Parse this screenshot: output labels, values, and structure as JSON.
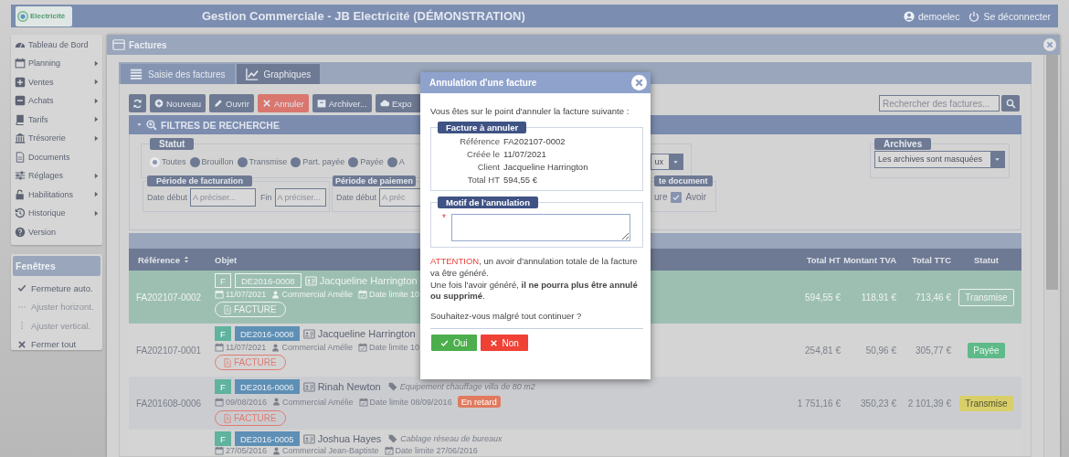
{
  "header": {
    "logo_text": "Electricité",
    "title": "Gestion Commerciale - JB Electricité (DÉMONSTRATION)",
    "user": "demoelec",
    "logout": "Se déconnecter"
  },
  "sidebar": {
    "items": [
      {
        "label": "Tableau de Bord",
        "submenu": false
      },
      {
        "label": "Planning",
        "submenu": true
      },
      {
        "label": "Ventes",
        "submenu": true
      },
      {
        "label": "Achats",
        "submenu": true
      },
      {
        "label": "Tarifs",
        "submenu": true
      },
      {
        "label": "Trésorerie",
        "submenu": true
      },
      {
        "label": "Documents",
        "submenu": false
      },
      {
        "label": "Réglages",
        "submenu": true
      },
      {
        "label": "Habilitations",
        "submenu": true
      },
      {
        "label": "Historique",
        "submenu": true
      },
      {
        "label": "Version",
        "submenu": false
      }
    ]
  },
  "windows_menu": {
    "title": "Fenêtres",
    "items": [
      {
        "label": "Fermeture auto.",
        "disabled": false
      },
      {
        "label": "Ajuster horizont.",
        "disabled": true
      },
      {
        "label": "Ajuster vertical.",
        "disabled": true
      },
      {
        "label": "Fermer tout",
        "disabled": false
      }
    ]
  },
  "window": {
    "title": "Factures"
  },
  "tabs": [
    {
      "label": "Saisie des factures",
      "selected": true
    },
    {
      "label": "Graphiques",
      "selected": false
    }
  ],
  "toolbar": {
    "buttons": [
      {
        "label": "Nouveau",
        "kind": "default"
      },
      {
        "label": "Ouvrir",
        "kind": "default"
      },
      {
        "label": "Annuler",
        "kind": "danger"
      },
      {
        "label": "Archiver...",
        "kind": "default"
      },
      {
        "label": "Expo",
        "kind": "default"
      }
    ]
  },
  "search": {
    "placeholder": "Rechercher des factures..."
  },
  "filters": {
    "title": "FILTRES DE RECHERCHE",
    "status": {
      "legend": "Statut",
      "options": [
        {
          "label": "Toutes",
          "selected": true
        },
        {
          "label": "Brouillon",
          "selected": false
        },
        {
          "label": "Transmise",
          "selected": false
        },
        {
          "label": "Part. payée",
          "selected": false
        },
        {
          "label": "Payée",
          "selected": false
        },
        {
          "label": "A",
          "selected": false
        }
      ],
      "select_value": "ux"
    },
    "billing_period": {
      "legend": "Période de facturation",
      "start_label": "Date début",
      "start_placeholder": "A préciser...",
      "end_label": "Fin",
      "end_placeholder": "A préciser..."
    },
    "payment_period": {
      "legend": "Période de paiemen",
      "start_label": "Date début",
      "start_placeholder": "A préc"
    },
    "document_type": {
      "legend": "te document",
      "partial_label": "ure",
      "options": [
        {
          "label": "Avoir",
          "checked": true
        }
      ]
    },
    "archives": {
      "legend": "Archives",
      "value": "Les archives sont masquées"
    }
  },
  "table": {
    "columns": [
      "Référence",
      "Objet",
      "Total HT",
      "Montant TVA",
      "Total TTC",
      "Statut"
    ],
    "rows": [
      {
        "reference": "FA202107-0002",
        "selected": true,
        "type": "F",
        "quote": "DE2016-0008",
        "client": "Jacqueline Harrington",
        "date": "11/07/2021",
        "sales_rep": "Commercial Amélie",
        "due": "Date limite 10",
        "document": "FACTURE",
        "total_ht": "594,55 €",
        "vat": "118,91 €",
        "total_ttc": "713,46 €",
        "status": {
          "label": "Transmise",
          "kind": "sent"
        }
      },
      {
        "reference": "FA202107-0001",
        "selected": false,
        "type": "F",
        "quote": "DE2016-0008",
        "client": "Jacqueline Harrington",
        "date": "11/07/2021",
        "sales_rep": "Commercial Amélie",
        "due": "Date limite 10",
        "document": "FACTURE",
        "total_ht": "254,81 €",
        "vat": "50,96 €",
        "total_ttc": "305,77 €",
        "status": {
          "label": "Payée",
          "kind": "paid"
        }
      },
      {
        "reference": "FA201608-0006",
        "selected": false,
        "type": "F",
        "quote": "DE2016-0006",
        "client": "Rinah Newton",
        "description": "Equipement chauffage villa de 80 m2",
        "date": "09/08/2016",
        "sales_rep": "Commercial Amélie",
        "due": "Date limite 08/09/2016",
        "late": "En retard",
        "document": "FACTURE",
        "total_ht": "1 751,16 €",
        "vat": "350,23 €",
        "total_ttc": "2 101,39 €",
        "status": {
          "label": "Transmise",
          "kind": "sent"
        }
      },
      {
        "selected": false,
        "type": "F",
        "quote": "DE2016-0005",
        "client": "Joshua Hayes",
        "description": "Cablage réseau de bureaux",
        "date": "27/05/2016",
        "sales_rep": "Commercial Jean-Baptiste",
        "due": "Date limite 27/06/2016"
      }
    ]
  },
  "dialog": {
    "title": "Annulation d'une facture",
    "intro": "Vous êtes sur le point d'annuler la facture suivante :",
    "invoice_legend": "Facture à annuler",
    "fields": [
      {
        "label": "Référence",
        "value": "FA202107-0002"
      },
      {
        "label": "Créée le",
        "value": "11/07/2021"
      },
      {
        "label": "Client",
        "value": "Jacqueline Harrington"
      },
      {
        "label": "Total HT",
        "value": "594,55 €"
      }
    ],
    "reason_legend": "Motif de l'annulation",
    "required_mark": "*",
    "warning_label": "ATTENTION",
    "warning": ", un avoir d'annulation totale de la facture va être généré.",
    "note": "Une fois l'avoir généré, **il ne pourra plus être annulé ou supprimé**.",
    "question": "Souhaitez-vous malgré tout continuer ?",
    "buttons": [
      {
        "label": "Oui",
        "kind": "confirm"
      },
      {
        "label": "Non",
        "kind": "cancel"
      }
    ]
  }
}
